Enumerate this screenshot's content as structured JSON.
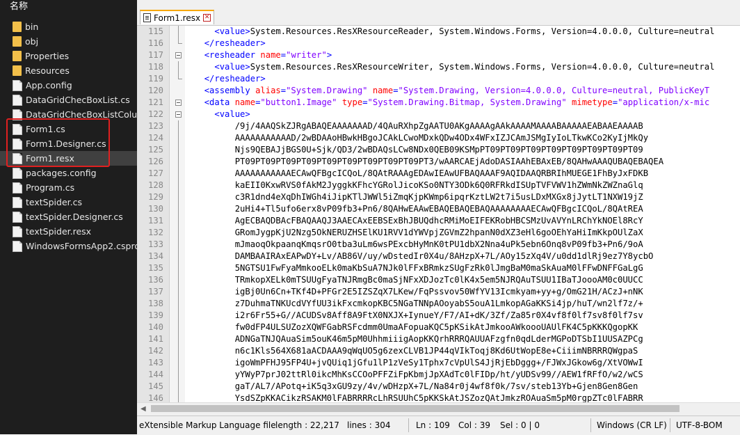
{
  "file_pane": {
    "title": "名称",
    "items": [
      {
        "name": "bin",
        "type": "folder"
      },
      {
        "name": "obj",
        "type": "folder"
      },
      {
        "name": "Properties",
        "type": "folder"
      },
      {
        "name": "Resources",
        "type": "folder"
      },
      {
        "name": "App.config",
        "type": "file"
      },
      {
        "name": "DataGridChecBoxList.cs",
        "type": "file"
      },
      {
        "name": "DataGridChecBoxListColumn.cs",
        "type": "file"
      },
      {
        "name": "Form1.cs",
        "type": "file"
      },
      {
        "name": "Form1.Designer.cs",
        "type": "file"
      },
      {
        "name": "Form1.resx",
        "type": "file",
        "selected": true
      },
      {
        "name": "packages.config",
        "type": "file"
      },
      {
        "name": "Program.cs",
        "type": "file"
      },
      {
        "name": "textSpider.cs",
        "type": "file"
      },
      {
        "name": "textSpider.Designer.cs",
        "type": "file"
      },
      {
        "name": "textSpider.resx",
        "type": "file"
      },
      {
        "name": "WindowsFormsApp2.csproj",
        "type": "file"
      }
    ]
  },
  "editor": {
    "tab_label": "Form1.resx",
    "lines": [
      {
        "n": "115",
        "fold": "line",
        "parts": [
          [
            "x",
            "    "
          ],
          [
            "t",
            "<value>"
          ],
          [
            "x",
            "System.Resources.ResXResourceReader, System.Windows.Forms, Version=4.0.0.0, Culture=neutral"
          ]
        ]
      },
      {
        "n": "116",
        "fold": "end",
        "parts": [
          [
            "x",
            "  "
          ],
          [
            "t",
            "</resheader>"
          ]
        ]
      },
      {
        "n": "117",
        "fold": "box",
        "parts": [
          [
            "x",
            "  "
          ],
          [
            "t",
            "<resheader "
          ],
          [
            "a",
            "name"
          ],
          [
            "t",
            "="
          ],
          [
            "v",
            "\"writer\""
          ],
          [
            "t",
            ">"
          ]
        ]
      },
      {
        "n": "118",
        "fold": "line",
        "parts": [
          [
            "x",
            "    "
          ],
          [
            "t",
            "<value>"
          ],
          [
            "x",
            "System.Resources.ResXResourceWriter, System.Windows.Forms, Version=4.0.0.0, Culture=neutral"
          ]
        ]
      },
      {
        "n": "119",
        "fold": "end",
        "parts": [
          [
            "x",
            "  "
          ],
          [
            "t",
            "</resheader>"
          ]
        ]
      },
      {
        "n": "120",
        "fold": "",
        "parts": [
          [
            "x",
            "  "
          ],
          [
            "t",
            "<assembly "
          ],
          [
            "a",
            "alias"
          ],
          [
            "t",
            "="
          ],
          [
            "v",
            "\"System.Drawing\" "
          ],
          [
            "a",
            "name"
          ],
          [
            "t",
            "="
          ],
          [
            "v",
            "\"System.Drawing, Version=4.0.0.0, Culture=neutral, PublicKeyT"
          ]
        ]
      },
      {
        "n": "121",
        "fold": "box",
        "parts": [
          [
            "x",
            "  "
          ],
          [
            "t",
            "<data "
          ],
          [
            "a",
            "name"
          ],
          [
            "t",
            "="
          ],
          [
            "v",
            "\"button1.Image\" "
          ],
          [
            "a",
            "type"
          ],
          [
            "t",
            "="
          ],
          [
            "v",
            "\"System.Drawing.Bitmap, System.Drawing\" "
          ],
          [
            "a",
            "mimetype"
          ],
          [
            "t",
            "="
          ],
          [
            "v",
            "\"application/x-mic"
          ]
        ]
      },
      {
        "n": "122",
        "fold": "box",
        "parts": [
          [
            "x",
            "    "
          ],
          [
            "t",
            "<value>"
          ]
        ]
      },
      {
        "n": "123",
        "fold": "line",
        "parts": [
          [
            "x",
            "        /9j/4AAQSkZJRgABAQEAAAAAAAD/4QAuRXhpZgAATU0AKgAAAAgAAkAAAAMAAAABAAAAAEABAAEAAAAB"
          ]
        ]
      },
      {
        "n": "124",
        "fold": "line",
        "parts": [
          [
            "x",
            "        AAAAAAAAAAAD/2wBDAAoHBwkHBgoJCAkLCwoMDxkQDw4ODx4WFxIZJCAmJSMgIyIoLTkwKCo2KyIjMkQy"
          ]
        ]
      },
      {
        "n": "125",
        "fold": "line",
        "parts": [
          [
            "x",
            "        Njs9QEBAJjBGS0U+Sjk/QD3/2wBDAQsLCw8NDx0QEB09KSMpPT09PT09PT09PT09PT09PT09PT09PT09"
          ]
        ]
      },
      {
        "n": "126",
        "fold": "line",
        "parts": [
          [
            "x",
            "        PT09PT09PT09PT09PT09PT09PT09PT09PT09PT3/wAARCAEjAdoDASIAAhEBAxEB/8QAHwAAAQUBAQEBAQEA"
          ]
        ]
      },
      {
        "n": "127",
        "fold": "line",
        "parts": [
          [
            "x",
            "        AAAAAAAAAAAECAwQFBgcICQoL/8QAtRAAAgEDAwIEAwUFBAQAAAF9AQIDAAQRBRIhMUEGE1FhByJxFDKB"
          ]
        ]
      },
      {
        "n": "128",
        "fold": "line",
        "parts": [
          [
            "x",
            "        kaEII0KxwRVS0fAkM2JyggkKFhcYGRolJicoKSo0NTY3ODk6Q0RFRkdISUpTVFVWV1hZWmNkZWZnaGlq"
          ]
        ]
      },
      {
        "n": "129",
        "fold": "line",
        "parts": [
          [
            "x",
            "        c3R1dnd4eXqDhIWGh4iJipKTlJWWl5iZmqKjpKWmp6ipqrKztLW2t7i5usLDxMXGx8jJytLT1NXW19jZ"
          ]
        ]
      },
      {
        "n": "130",
        "fold": "line",
        "parts": [
          [
            "x",
            "        2uHi4+Tl5ufo6erx8vP09fb3+Pn6/8QAHwEAAwEBAQEBAQEBAQAAAAAAAAECAwQFBgcICQoL/8QAtREA"
          ]
        ]
      },
      {
        "n": "131",
        "fold": "line",
        "parts": [
          [
            "x",
            "        AgECBAQDBAcFBAQAAQJ3AAECAxEEBSExBhJBUQdhcRMiMoEIFEKRobHBCSMzUvAVYnLRChYkNOEl8RcY"
          ]
        ]
      },
      {
        "n": "132",
        "fold": "line",
        "parts": [
          [
            "x",
            "        GRomJygpKjU2Nzg5OkNERUZHSElKU1RVV1dYWVpjZGVmZ2hpanN0dXZ3eHl6goOEhYaHiImKkpOUlZaX"
          ]
        ]
      },
      {
        "n": "133",
        "fold": "line",
        "parts": [
          [
            "x",
            "        mJmaoqOkpaanqKmqsrO0tba3uLm6wsPExcbHyMnK0tPU1dbX2Nna4uPk5ebn6Onq8vP09fb3+Pn6/9oA"
          ]
        ]
      },
      {
        "n": "134",
        "fold": "line",
        "parts": [
          [
            "x",
            "        DAMBAAIRAxEAPwDY+Lv/AB86V/uy/wDstedIr0X4u/8AHzpX+7L/AOy15zXq4V/u0dd1dlRj9ez7Y8ycbO"
          ]
        ]
      },
      {
        "n": "135",
        "fold": "line",
        "parts": [
          [
            "x",
            "        5NGTSU1FwFyaMmkooELk0maKbSuA7NJk0lFFxBRmkzSUgFzRk0lJmgBaM0maSkAuaM0lFFwDNFFGaLgG"
          ]
        ]
      },
      {
        "n": "136",
        "fold": "line",
        "parts": [
          [
            "x",
            "        TRmkopXELk0mTSUUgFyaTNJRmgBc0maSjNFxXDJozTc0lK4x5em5NJRQAuTSUU1IBaTJoooAM0c0UUCC"
          ]
        ]
      },
      {
        "n": "137",
        "fold": "line",
        "parts": [
          [
            "x",
            "        igBj0Un6Cn+TKf4D+PFGr2E5IZSZqX7LKew/FqPssvov50WfYV13Icmkyam+yy+g/OmG21H/ACzJ+nNK"
          ]
        ]
      },
      {
        "n": "138",
        "fold": "line",
        "parts": [
          [
            "x",
            "        z7DuhmaTNKUcdVYfUU3ikFxcmkopKBC5NGaTNNpAOoyabS5ouA1LmkopAGaKKSi4jp/huT/wn2lf7z/+"
          ]
        ]
      },
      {
        "n": "139",
        "fold": "line",
        "parts": [
          [
            "x",
            "        i2r6Fr55+G//ACUDSv8Aff8A9FtX0NXJX+IynueY/F7/AI+dK/3Zf/Za85r0X4vf8f0lf7sv8f0lf7sv"
          ]
        ]
      },
      {
        "n": "140",
        "fold": "line",
        "parts": [
          [
            "x",
            "        fw0dFP4ULSUZozXQWFGabRSFcdmm0UmaAFopuaKQC5pKSikAtJmkooAWkoooUAUlFK4C5pKKKQgopKK"
          ]
        ]
      },
      {
        "n": "141",
        "fold": "line",
        "parts": [
          [
            "x",
            "        ADNGaTNJQAuaSim5ouK46m5pM0UhhmiiigAopKKQrhRRRQAUUAFzgfn0qdLderMGPoDTSbI1UUSAZPCg"
          ]
        ]
      },
      {
        "n": "142",
        "fold": "line",
        "parts": [
          [
            "x",
            "        n6c1Kls564X681aACDAAA9qWqUO5g6zexCLVB1JP44qVIkToqj8Kd6UtWopE8e+CiiimNBRRRQWgpaS"
          ]
        ]
      },
      {
        "n": "143",
        "fold": "line",
        "parts": [
          [
            "x",
            "        igoWmPFHJ95FP4U+jvQUiq1jGfu1lP1zVeSy1Tphx7cVpUlS4JjRjEbDggg+/FJWxJGkow6g/XtVOWwI"
          ]
        ]
      },
      {
        "n": "144",
        "fold": "line",
        "parts": [
          [
            "x",
            "        yYWyP7prJ02ttRl0ikcMhKsCCOoPFFZiFpKbmjJpXAdTc0lFIDp/ht/yUDSv99//AEW1fRFfO/w2/wCS"
          ]
        ]
      },
      {
        "n": "145",
        "fold": "line",
        "parts": [
          [
            "x",
            "        gaT/AL7/APotq+iK5q3xGU9zy/4v/wDHzpX+7L/Na84r0j4wf8f0k/7sv/steb13Yb+Gjen8Gen8Gen"
          ]
        ]
      },
      {
        "n": "146",
        "fold": "line",
        "parts": [
          [
            "x",
            "        YsdSZpKKACikzRSAKM0lFABRRRRcLhRSUUhC5pKKSkAtJSZozQAtJmkzROAuaSm5pM0rgpZTc0lFABRR"
          ]
        ]
      }
    ]
  },
  "status": {
    "file_type": "eXtensible Markup Language file",
    "length": "length : 22,217",
    "lines": "lines : 304",
    "ln": "Ln : 109",
    "col": "Col : 39",
    "sel": "Sel : 0 | 0",
    "eol": "Windows (CR LF)",
    "encoding": "UTF-8-BOM"
  }
}
